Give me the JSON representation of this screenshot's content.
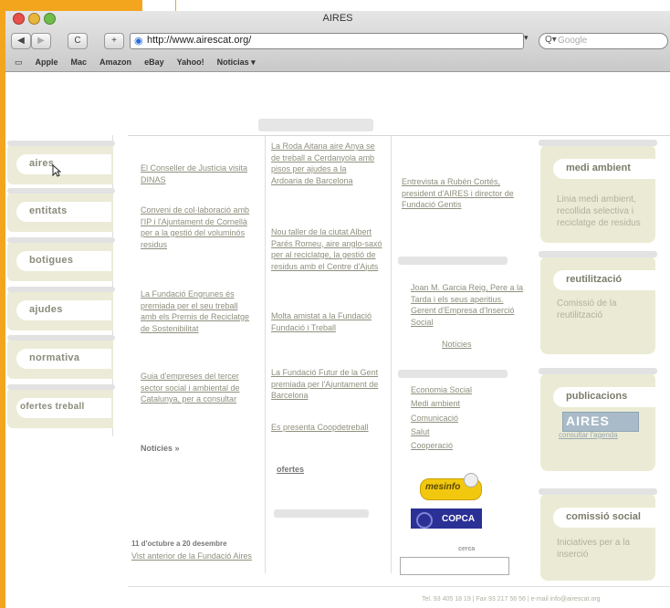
{
  "window": {
    "title": "AIRES"
  },
  "toolbar": {
    "back": "◀",
    "forward": "▶",
    "reload": "C",
    "add": "+",
    "url": "http://www.airescat.org/",
    "search_placeholder": "Google"
  },
  "bookmarks": [
    "Apple",
    "Mac",
    "Amazon",
    "eBay",
    "Yahoo!",
    "Noticias ▾"
  ],
  "nav": [
    "aires",
    "entitats",
    "botigues",
    "ajudes",
    "normativa",
    "ofertes treball"
  ],
  "col1": {
    "items": [
      "El Conseller de Justícia visita DINAS",
      "Conveni de col·laboració amb l'IP i l'Ajuntament de Cornellà per a la gestió del voluminós residus",
      "La Fundació Engrunes és premiada per el seu treball amb els Premis de Reciclatge de Sostenibilitat",
      "Guia d'empreses del tercer sector social i ambiental de Catalunya, per a consultar"
    ],
    "more": "Notícies »",
    "event_date": "11 d'octubre a 20 desembre",
    "event_link": "Vist anterior de la Fundació Aires"
  },
  "col2": {
    "items": [
      "La Roda Aitana aire Anya se de treball a Cerdanyola amb pisos per ajudes a la Ardoaria de Barcelona",
      "Nou taller de la ciutat Albert Parés Romeu, aire anglo-saxó per al reciclatge, la gestió de residus amb el Centre d'Ajuts",
      "Molta amistat a la Fundació Fundació i Treball",
      "La Fundació Futur de la Gent premiada per l'Ajuntament de Barcelona",
      "Es presenta Coopdetreball"
    ],
    "more": "ofertes"
  },
  "col3": {
    "news_item": "Entrevista a Rubén Cortés, president d'AIRES i director de Fundació Gentis",
    "person_item": "Joan M. Garcia Reig, Pere a la Tarda i els seus aperitius. Gerent d'Empresa d'Inserció Social",
    "more": "Notícies",
    "links": [
      "Economia Social",
      "Medi ambient",
      "Comunicació",
      "Salut",
      "Cooperació"
    ],
    "logo1": "mesinfo",
    "logo2": "COPCA",
    "search_label": "cerca",
    "search_value": ""
  },
  "right": {
    "boxes": [
      {
        "title": "medi ambient",
        "text": "Linia medi ambient, recollida selectiva i reciclatge de residus"
      },
      {
        "title": "reutilització",
        "text": "Comissió de la reutilització"
      },
      {
        "title": "publicacions",
        "text": ""
      },
      {
        "title": "comissió social",
        "text": "Iniciatives per a la inserció"
      }
    ],
    "pub_image": "AIRES",
    "pub_sub": "consultar l'agenda"
  },
  "footer": "Tel. 93 405 18 19 | Fax 93 217 56 56 | e-mail info@airescat.org",
  "colors": {
    "accent": "#f3a51e",
    "tab_bg": "#ebebd5"
  }
}
